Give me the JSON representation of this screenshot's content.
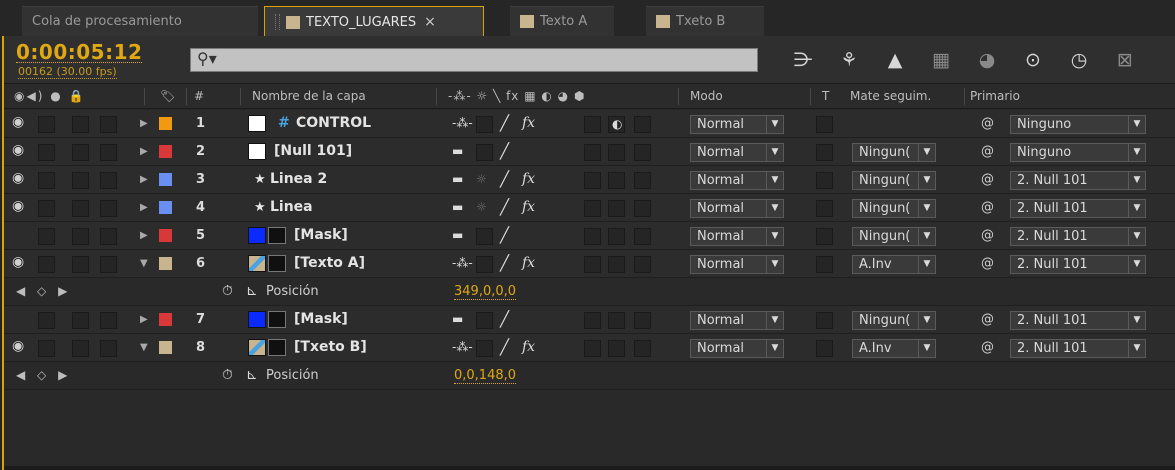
{
  "tabs": [
    {
      "label": "Cola de procesamiento",
      "color": ""
    },
    {
      "label": "TEXTO_LUGARES",
      "color": "#c8b590",
      "close": "×"
    },
    {
      "label": "Texto A",
      "color": "#c8b590"
    },
    {
      "label": "Txeto B",
      "color": "#c8b590"
    }
  ],
  "toolbar": {
    "timecode": "0:00:05:12",
    "frames": "00162 (30.00 fps)",
    "search_value": "",
    "search_icon": "search-icon",
    "icons": [
      "draft-3d-icon",
      "hide-shy-icon",
      "frame-blending-icon",
      "motion-blur-icon",
      "brainstorm-icon",
      "graph-editor-icon",
      "live-update-icon"
    ]
  },
  "header": {
    "av": "◉◀) ● 🔒",
    "label_col": "🏷",
    "num_col": "#",
    "name": "Nombre de la capa",
    "switches": "-⁂- ☼ ╲ fx ▦ ◐ ◕ ⬢",
    "mode": "Modo",
    "t": "T",
    "trkmat": "Mate seguim.",
    "parent": "Primario"
  },
  "layers": [
    {
      "num": "1",
      "name": "CONTROL",
      "label_color": "#f29a0f",
      "expanded": false,
      "eye": true,
      "kind": "adjust",
      "mode": "Normal",
      "trkmat": "",
      "parent": "Ninguno",
      "fx": true,
      "sw1": "-⁂-",
      "sun": false,
      "motionblur": true
    },
    {
      "num": "2",
      "name": "[Null 101]",
      "label_color": "#d9383a",
      "expanded": false,
      "eye": true,
      "kind": "null",
      "mode": "Normal",
      "trkmat": "Ningun(",
      "parent": "Ninguno",
      "fx": false,
      "sw1": "▬",
      "sun": false,
      "motionblur": false
    },
    {
      "num": "3",
      "name": "Linea 2",
      "label_color": "#6b8ff0",
      "expanded": false,
      "eye": true,
      "kind": "shape",
      "mode": "Normal",
      "trkmat": "Ningun(",
      "parent": "2. Null 101",
      "fx": true,
      "sw1": "▬",
      "sun": true,
      "motionblur": false
    },
    {
      "num": "4",
      "name": "Linea",
      "label_color": "#6b8ff0",
      "expanded": false,
      "eye": true,
      "kind": "shape",
      "mode": "Normal",
      "trkmat": "Ningun(",
      "parent": "2. Null 101",
      "fx": true,
      "sw1": "▬",
      "sun": true,
      "motionblur": false
    },
    {
      "num": "5",
      "name": "[Mask]",
      "label_color": "#d9383a",
      "expanded": false,
      "eye": false,
      "kind": "solid",
      "mode": "Normal",
      "trkmat": "Ningun(",
      "parent": "2. Null 101",
      "fx": false,
      "sw1": "▬",
      "sun": false,
      "motionblur": false
    },
    {
      "num": "6",
      "name": "[Texto A]",
      "label_color": "#c8b590",
      "expanded": true,
      "eye": true,
      "kind": "comp",
      "mode": "Normal",
      "trkmat": "A.Inv",
      "parent": "2. Null 101",
      "fx": true,
      "sw1": "-⁂-",
      "sun": false,
      "motionblur": false,
      "prop": {
        "name": "Posición",
        "value": "349,0,0,0"
      }
    },
    {
      "num": "7",
      "name": "[Mask]",
      "label_color": "#d9383a",
      "expanded": false,
      "eye": false,
      "kind": "solid",
      "mode": "Normal",
      "trkmat": "Ningun(",
      "parent": "2. Null 101",
      "fx": false,
      "sw1": "▬",
      "sun": false,
      "motionblur": false
    },
    {
      "num": "8",
      "name": "[Txeto B]",
      "label_color": "#c8b590",
      "expanded": true,
      "eye": true,
      "kind": "comp",
      "mode": "Normal",
      "trkmat": "A.Inv",
      "parent": "2. Null 101",
      "fx": true,
      "sw1": "-⁂-",
      "sun": false,
      "motionblur": false,
      "prop": {
        "name": "Posición",
        "value": "0,0,148,0"
      }
    }
  ],
  "glyphs": {
    "eye": "◉",
    "expanded": "▼",
    "collapsed": "▶",
    "stopwatch": "⏱",
    "graph": "⊾",
    "nav": "◀ ◇ ▶",
    "spiral": "@",
    "dd_arrow": "▼",
    "star": "★",
    "adjust": "#"
  }
}
